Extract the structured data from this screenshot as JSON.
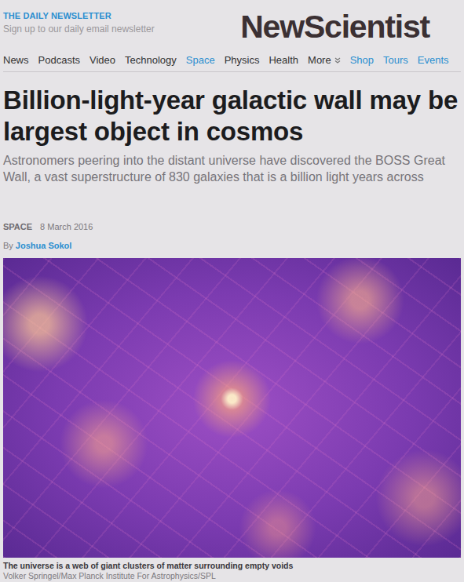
{
  "newsletter": {
    "title": "THE DAILY NEWSLETTER",
    "subtitle": "Sign up to our daily email newsletter"
  },
  "logo": "NewScientist",
  "nav": [
    {
      "label": "News",
      "selected": false,
      "kind": "section"
    },
    {
      "label": "Podcasts",
      "selected": false,
      "kind": "section"
    },
    {
      "label": "Video",
      "selected": false,
      "kind": "section"
    },
    {
      "label": "Technology",
      "selected": false,
      "kind": "section"
    },
    {
      "label": "Space",
      "selected": true,
      "kind": "section"
    },
    {
      "label": "Physics",
      "selected": false,
      "kind": "section"
    },
    {
      "label": "Health",
      "selected": false,
      "kind": "section"
    },
    {
      "label": "More",
      "selected": false,
      "kind": "menu"
    },
    {
      "label": "Shop",
      "selected": false,
      "kind": "link"
    },
    {
      "label": "Tours",
      "selected": false,
      "kind": "link"
    },
    {
      "label": "Events",
      "selected": false,
      "kind": "link"
    }
  ],
  "article": {
    "headline": "Billion-light-year galactic wall may be largest object in cosmos",
    "standfirst": "Astronomers peering into the distant universe have discovered the BOSS Great Wall, a vast superstructure of 830 galaxies that is a billion light years across",
    "section": "SPACE",
    "date": "8 March 2016",
    "byline_prefix": "By",
    "author": "Joshua Sokol",
    "image": {
      "caption": "The universe is a web of giant clusters of matter surrounding empty voids",
      "credit": "Volker Springel/Max Planck Institute For Astrophysics/SPL"
    }
  }
}
